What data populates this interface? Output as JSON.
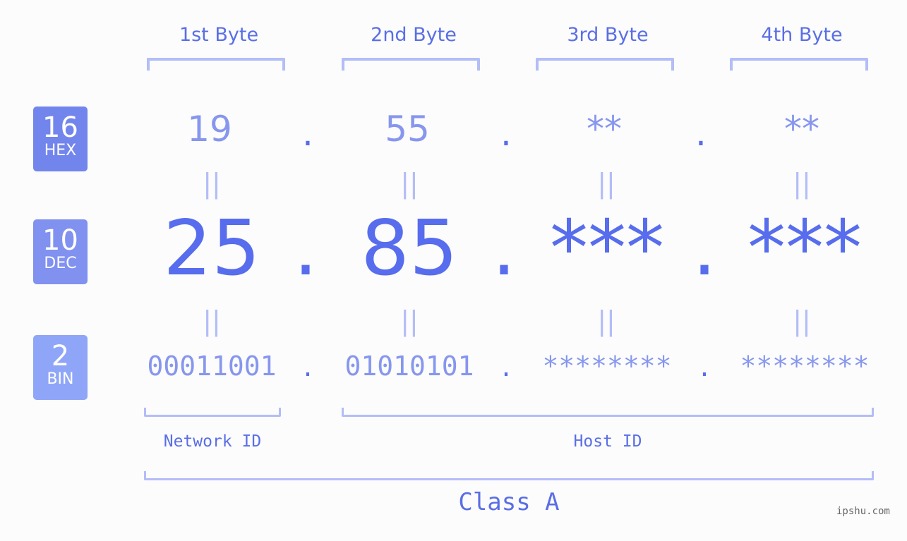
{
  "bytes": [
    {
      "label": "1st Byte",
      "hex": "19",
      "dec": "25",
      "bin": "00011001"
    },
    {
      "label": "2nd Byte",
      "hex": "55",
      "dec": "85",
      "bin": "01010101"
    },
    {
      "label": "3rd Byte",
      "hex": "**",
      "dec": "***",
      "bin": "********"
    },
    {
      "label": "4th Byte",
      "hex": "**",
      "dec": "***",
      "bin": "********"
    }
  ],
  "bases": {
    "hex": {
      "number": "16",
      "unit": "HEX",
      "color": "#7285ec"
    },
    "dec": {
      "number": "10",
      "unit": "DEC",
      "color": "#8191f0"
    },
    "bin": {
      "number": "2",
      "unit": "BIN",
      "color": "#8fa6f8"
    }
  },
  "separator": ".",
  "equals": "||",
  "network_id_label": "Network ID",
  "host_id_label": "Host ID",
  "class_label": "Class A",
  "watermark": "ipshu.com",
  "colors": {
    "accent": "#576ded",
    "light_value": "#8796ee",
    "bracket": "#b3bdf7"
  }
}
